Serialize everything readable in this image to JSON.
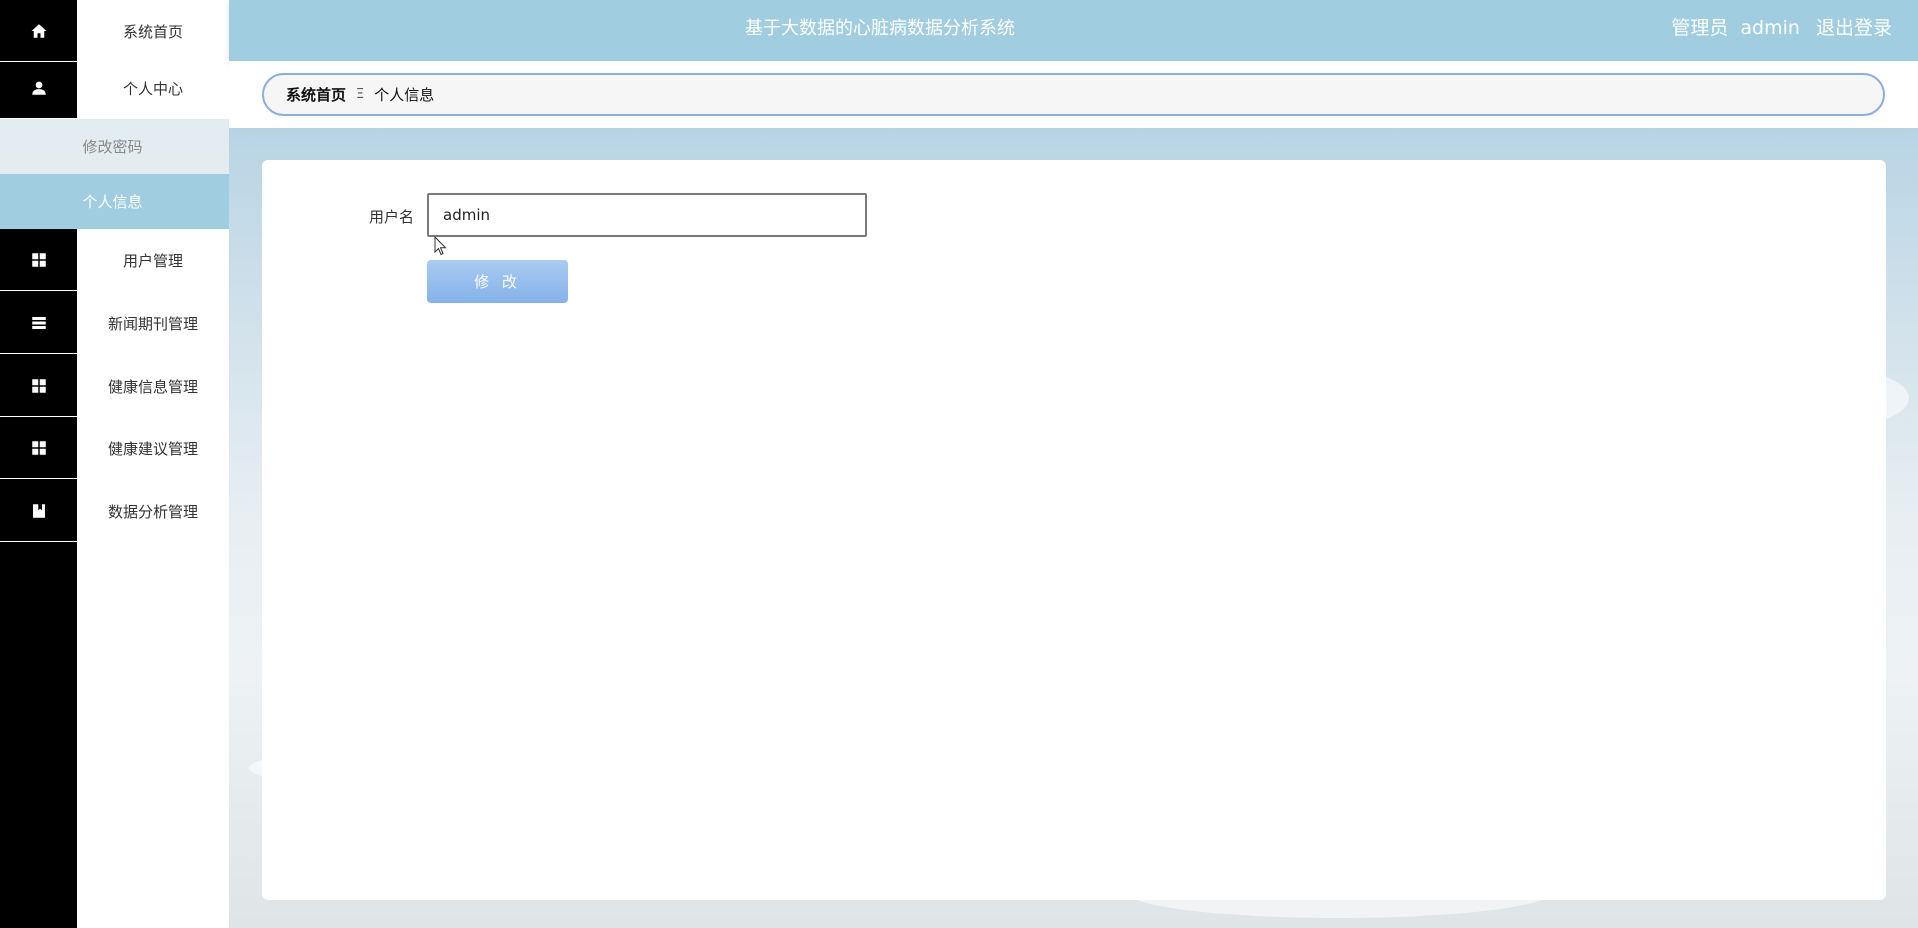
{
  "app": {
    "title": "基于大数据的心脏病数据分析系统"
  },
  "header": {
    "user_role": "管理员",
    "username": "admin",
    "logout_label": "退出登录"
  },
  "sidebar": {
    "items": [
      {
        "label": "系统首页",
        "icon": "home-icon"
      },
      {
        "label": "个人中心",
        "icon": "user-icon"
      },
      {
        "label": "用户管理",
        "icon": "grid-icon"
      },
      {
        "label": "新闻期刊管理",
        "icon": "list-icon"
      },
      {
        "label": "健康信息管理",
        "icon": "grid-icon"
      },
      {
        "label": "健康建议管理",
        "icon": "grid-icon"
      },
      {
        "label": "数据分析管理",
        "icon": "book-icon"
      }
    ],
    "subitems": [
      {
        "label": "修改密码"
      },
      {
        "label": "个人信息",
        "active": true
      }
    ]
  },
  "breadcrumb": {
    "home": "系统首页",
    "separator": "Ξ",
    "current": "个人信息"
  },
  "form": {
    "username_label": "用户名",
    "username_value": "admin",
    "submit_label": "修 改"
  },
  "colors": {
    "header_bg": "#a0cde0",
    "active_sub_bg": "#a0cde0",
    "icon_strip_bg": "#000000",
    "button_bg": "#86b2ea"
  }
}
